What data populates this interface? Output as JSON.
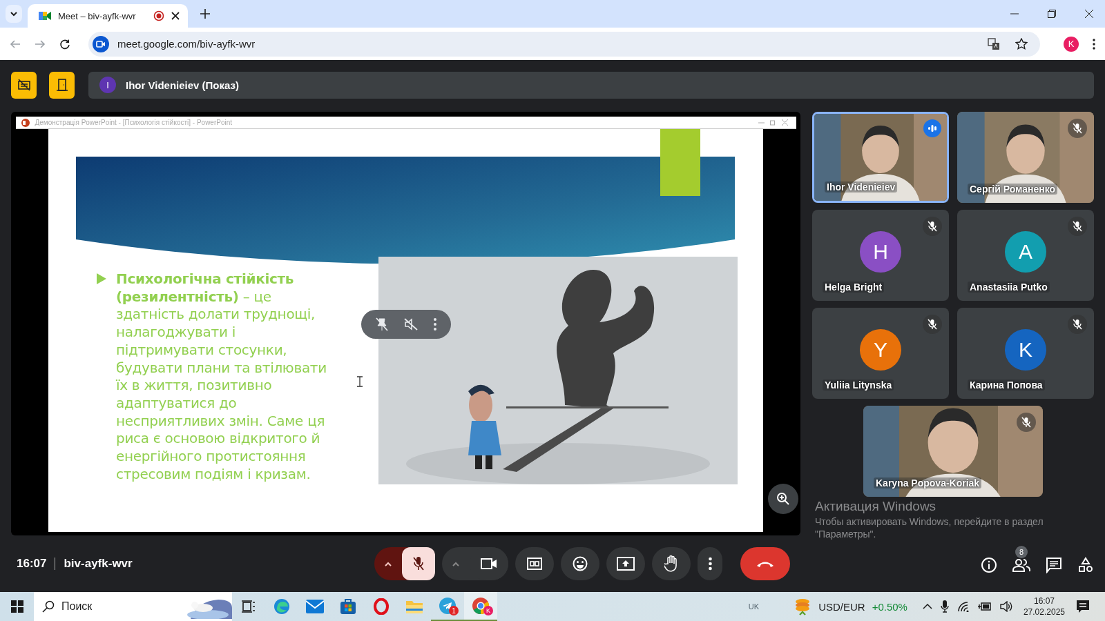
{
  "browser": {
    "tab": {
      "title": "Meet – biv-ayfk-wvr",
      "recording": true
    },
    "address": "meet.google.com/biv-ayfk-wvr",
    "profile_initial": "K"
  },
  "presenter_bar": {
    "initial": "I",
    "name": "Ihor Videnieiev (Показ)"
  },
  "presentation": {
    "window_title": "Демонстрація PowerPoint - [Психологія стійкості] - PowerPoint",
    "bullet_text": "**Психологічна стійкість (резилентність)** – це здатність долати труднощі, налагоджувати і підтримувати стосунки, будувати плани та втілювати їх в життя, позитивно адаптуватися до несприятливих змін. Саме ця риса є основою відкритого й енергійного протистояння стресовим подіям і кризам."
  },
  "tiles": [
    {
      "kind": "video",
      "name": "Ihor Videnieiev",
      "speaking": true,
      "muted": false
    },
    {
      "kind": "video",
      "name": "Сергій Романенко",
      "speaking": false,
      "muted": true
    },
    {
      "kind": "avatar",
      "initial": "H",
      "name": "Helga Bright",
      "color": "#8a4fc4",
      "speaking": false,
      "muted": true
    },
    {
      "kind": "avatar",
      "initial": "A",
      "name": "Anastasiia Putko",
      "color": "#129eaf",
      "speaking": false,
      "muted": true
    },
    {
      "kind": "avatar",
      "initial": "Y",
      "name": "Yuliia Litynska",
      "color": "#e8710a",
      "speaking": false,
      "muted": true
    },
    {
      "kind": "avatar",
      "initial": "K",
      "name": "Карина Попова",
      "color": "#1565c0",
      "speaking": false,
      "muted": true
    },
    {
      "kind": "video",
      "name": "Karyna Popova-Koriak",
      "speaking": false,
      "muted": true
    }
  ],
  "activation": {
    "title": "Активация Windows",
    "text": "Чтобы активировать Windows, перейдите в раздел \"Параметры\"."
  },
  "bottom_bar": {
    "time": "16:07",
    "code": "biv-ayfk-wvr",
    "mic_muted": true,
    "camera_on": true,
    "people_count": "8"
  },
  "taskbar": {
    "search_placeholder": "Поиск",
    "apps": [
      {
        "kind": "taskview",
        "running": false,
        "active": false
      },
      {
        "kind": "edge",
        "running": false,
        "active": false
      },
      {
        "kind": "mail",
        "running": false,
        "active": false
      },
      {
        "kind": "store",
        "running": false,
        "active": false
      },
      {
        "kind": "opera",
        "running": false,
        "active": false
      },
      {
        "kind": "explorer",
        "running": false,
        "active": false
      },
      {
        "kind": "telegram",
        "running": true,
        "active": false,
        "badge": "1"
      },
      {
        "kind": "chrome",
        "running": true,
        "active": true,
        "profile": "K"
      }
    ],
    "language": "UK",
    "ticker": {
      "pair": "USD/EUR",
      "change": "+0.50%"
    },
    "time": "16:07",
    "date": "27.02.2025"
  }
}
